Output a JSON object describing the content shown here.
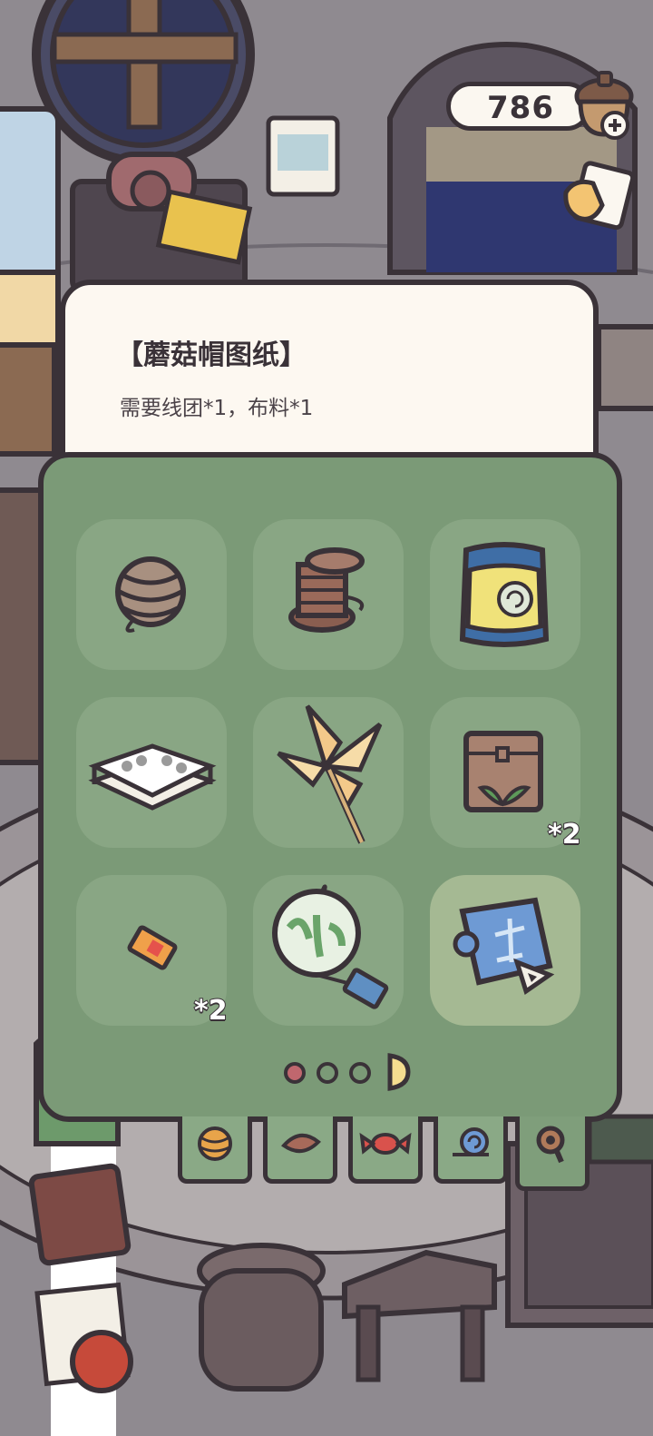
{
  "coins": {
    "value": "786",
    "add_icon": "plus-icon",
    "coin_icon": "acorn-coin-icon"
  },
  "tooltip": {
    "title": "【蘑菇帽图纸】",
    "description": "需要线团*1，布料*1"
  },
  "inventory": {
    "slots": [
      {
        "icon": "yarn-ball-icon",
        "count": ""
      },
      {
        "icon": "thread-spool-icon",
        "count": ""
      },
      {
        "icon": "snail-food-bag-icon",
        "count": ""
      },
      {
        "icon": "fabric-sample-book-icon",
        "count": ""
      },
      {
        "icon": "pinwheel-icon",
        "count": ""
      },
      {
        "icon": "seed-bag-icon",
        "count": "*2"
      },
      {
        "icon": "ticket-icon",
        "count": "*2"
      },
      {
        "icon": "wind-chime-icon",
        "count": ""
      },
      {
        "icon": "blueprint-icon",
        "count": ""
      }
    ],
    "pagination": {
      "pages": 3,
      "current": 1
    }
  },
  "tabs": [
    {
      "icon": "yarn-tab-icon"
    },
    {
      "icon": "leaf-tab-icon"
    },
    {
      "icon": "candy-tab-icon"
    },
    {
      "icon": "snail-tab-icon"
    },
    {
      "icon": "magnifier-tab-icon"
    }
  ],
  "colors": {
    "panel": "#7b9a77",
    "slot": "#89a684",
    "slot_selected": "#a5b993",
    "outline": "#3a3238",
    "cream": "#fdf8f1",
    "pager_active": "#c0676e"
  }
}
